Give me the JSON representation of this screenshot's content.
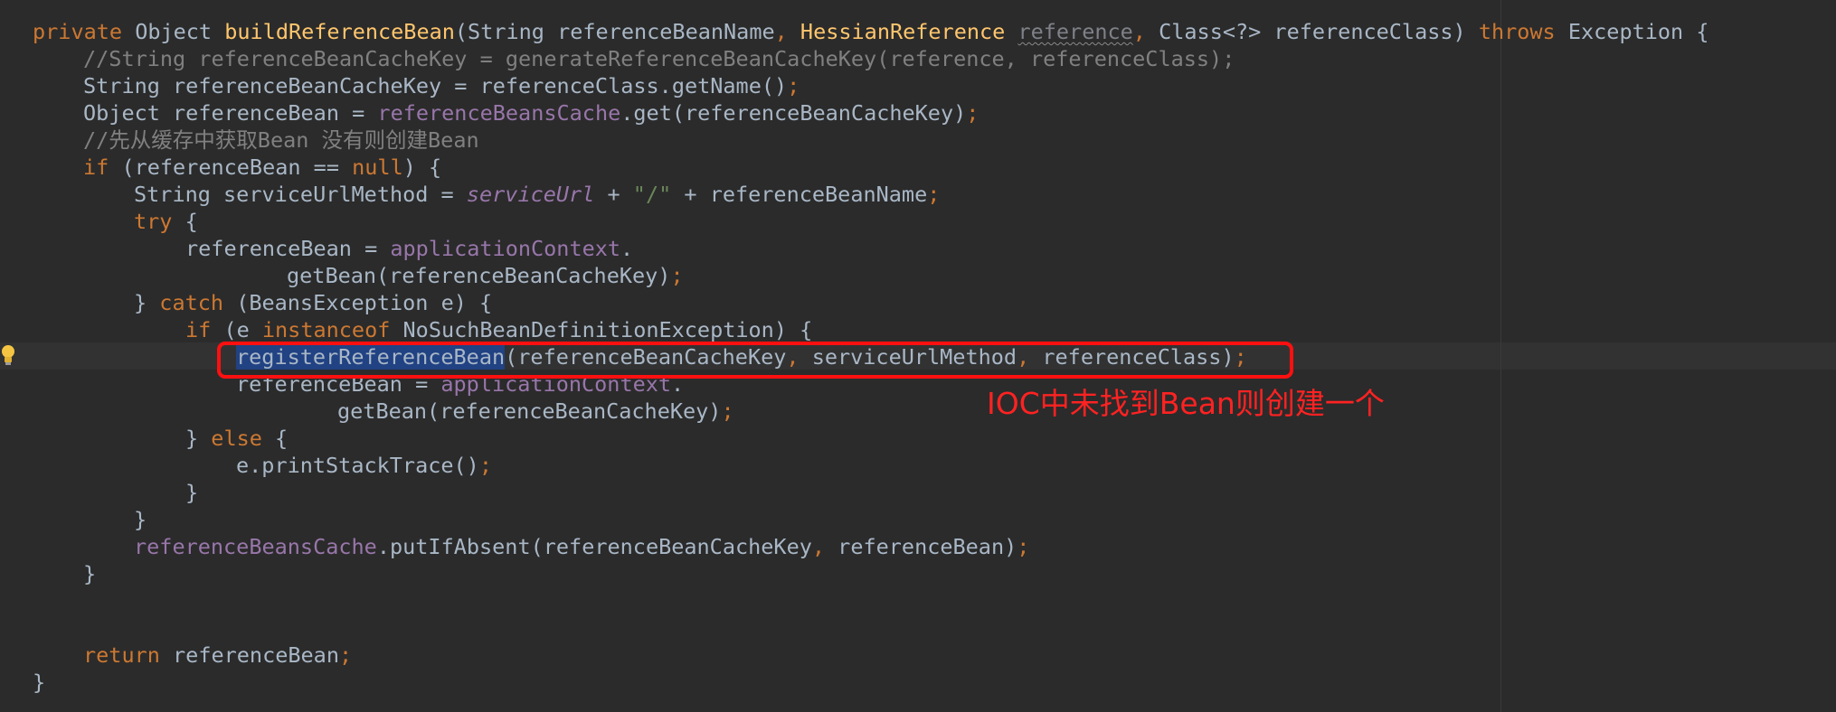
{
  "colors": {
    "background": "#2b2b2b",
    "keyword": "#cc7832",
    "method_declaration": "#ffc66d",
    "comment": "#808080",
    "field": "#9876aa",
    "string": "#6a8759",
    "plain": "#a9b7c6",
    "selection": "#214283",
    "annotation_red": "#ff2222"
  },
  "icons": {
    "gutter_bulb": "lightbulb-icon"
  },
  "code": {
    "l1": {
      "kw_private": "private",
      "t_object": " Object ",
      "fn_name": "buildReferenceBean",
      "t_params1": "(String referenceBeanName",
      "c_comma1": ",",
      "fn_hessian": " HessianReference ",
      "warn_reference": "reference",
      "c_comma2": ",",
      "t_params2": " Class<?> referenceClass) ",
      "kw_throws": "throws",
      "t_exc": " Exception {"
    },
    "l2": {
      "comment": "//String referenceBeanCacheKey = generateReferenceBeanCacheKey(reference, referenceClass);"
    },
    "l3": {
      "t": "String referenceBeanCacheKey = referenceClass.getName()",
      "semi": ";"
    },
    "l4": {
      "t1": "Object referenceBean = ",
      "field": "referenceBeansCache",
      "t2": ".get(referenceBeanCacheKey)",
      "semi": ";"
    },
    "l5": {
      "comment": "//先从缓存中获取Bean 没有则创建Bean"
    },
    "l6": {
      "kw_if": "if",
      "t1": " (referenceBean == ",
      "kw_null": "null",
      "t2": ") {"
    },
    "l7": {
      "t1": "String serviceUrlMethod = ",
      "it_field": "serviceUrl",
      "t2": " + ",
      "str": "\"/\"",
      "t3": " + referenceBeanName",
      "semi": ";"
    },
    "l8": {
      "kw_try": "try",
      "t": " {"
    },
    "l9": {
      "t1": "referenceBean = ",
      "field": "applicationContext",
      "t2": "."
    },
    "l10": {
      "t": "getBean(referenceBeanCacheKey)",
      "semi": ";"
    },
    "l11": {
      "t1": "} ",
      "kw_catch": "catch",
      "t2": " (BeansException e) {"
    },
    "l12": {
      "kw_if": "if",
      "t1": " (e ",
      "kw_instanceof": "instanceof",
      "t2": " NoSuchBeanDefinitionException) {"
    },
    "l13": {
      "sel": "registerReferenceBean",
      "t1": "(referenceBeanCacheKey",
      "c1": ",",
      "t2": " serviceUrlMethod",
      "c2": ",",
      "t3": " referenceClass)",
      "semi": ";"
    },
    "l14": {
      "t1": "referenceBean = ",
      "field": "applicationContext",
      "t2": "."
    },
    "l15": {
      "t": "getBean(referenceBeanCacheKey)",
      "semi": ";"
    },
    "l16": {
      "t1": "} ",
      "kw_else": "else",
      "t2": " {"
    },
    "l17": {
      "t": "e.printStackTrace()",
      "semi": ";"
    },
    "l18": {
      "t": "}"
    },
    "l19": {
      "t": "}"
    },
    "l20": {
      "field": "referenceBeansCache",
      "t1": ".putIfAbsent(referenceBeanCacheKey",
      "c1": ",",
      "t2": " referenceBean)",
      "semi": ";"
    },
    "l21": {
      "t": "}"
    },
    "l22": {
      "kw_return": "return",
      "t": " referenceBean",
      "semi": ";"
    },
    "l23": {
      "t": "}"
    }
  },
  "annotation": {
    "note": "IOC中未找到Bean则创建一个"
  }
}
